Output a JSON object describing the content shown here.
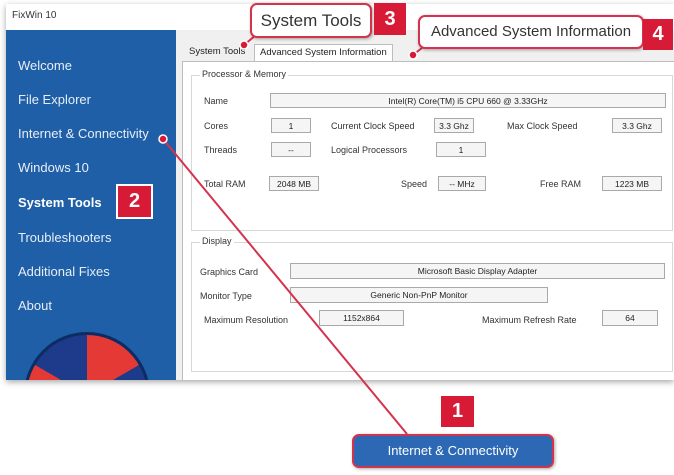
{
  "window": {
    "title": "FixWin 10"
  },
  "sidebar": {
    "items": [
      {
        "label": "Welcome"
      },
      {
        "label": "File Explorer"
      },
      {
        "label": "Internet & Connectivity"
      },
      {
        "label": "Windows 10"
      },
      {
        "label": "System Tools"
      },
      {
        "label": "Troubleshooters"
      },
      {
        "label": "Additional Fixes"
      },
      {
        "label": "About"
      }
    ],
    "active": "System Tools"
  },
  "tabs": [
    {
      "label": "System Tools"
    },
    {
      "label": "Advanced System Information"
    }
  ],
  "processor_memory": {
    "title": "Processor & Memory",
    "name_label": "Name",
    "name_value": "Intel(R) Core(TM) i5 CPU        660 @ 3.33GHz",
    "cores_label": "Cores",
    "cores_value": "1",
    "current_clock_label": "Current Clock Speed",
    "current_clock_value": "3.3 Ghz",
    "max_clock_label": "Max Clock Speed",
    "max_clock_value": "3.3 Ghz",
    "threads_label": "Threads",
    "threads_value": "--",
    "logical_processors_label": "Logical Processors",
    "logical_processors_value": "1",
    "total_ram_label": "Total RAM",
    "total_ram_value": "2048 MB",
    "speed_label": "Speed",
    "speed_value": "-- MHz",
    "free_ram_label": "Free RAM",
    "free_ram_value": "1223 MB"
  },
  "display": {
    "title": "Display",
    "graphics_card_label": "Graphics Card",
    "graphics_card_value": "Microsoft Basic Display Adapter",
    "monitor_type_label": "Monitor Type",
    "monitor_type_value": "Generic Non-PnP Monitor",
    "max_resolution_label": "Maximum Resolution",
    "max_resolution_value": "1152x864",
    "max_refresh_label": "Maximum Refresh Rate",
    "max_refresh_value": "64"
  },
  "callouts": {
    "system_tools": {
      "text": "System Tools",
      "number": "3"
    },
    "advanced": {
      "text": "Advanced System Information",
      "number": "4"
    },
    "sidebar_system_tools": {
      "number": "2"
    },
    "internet": {
      "text": "Internet & Connectivity",
      "number": "1"
    }
  },
  "colors": {
    "sidebar_bg": "#1f5fa7",
    "callout_red": "#d71a36",
    "panel_bg": "#f0f0f0"
  }
}
